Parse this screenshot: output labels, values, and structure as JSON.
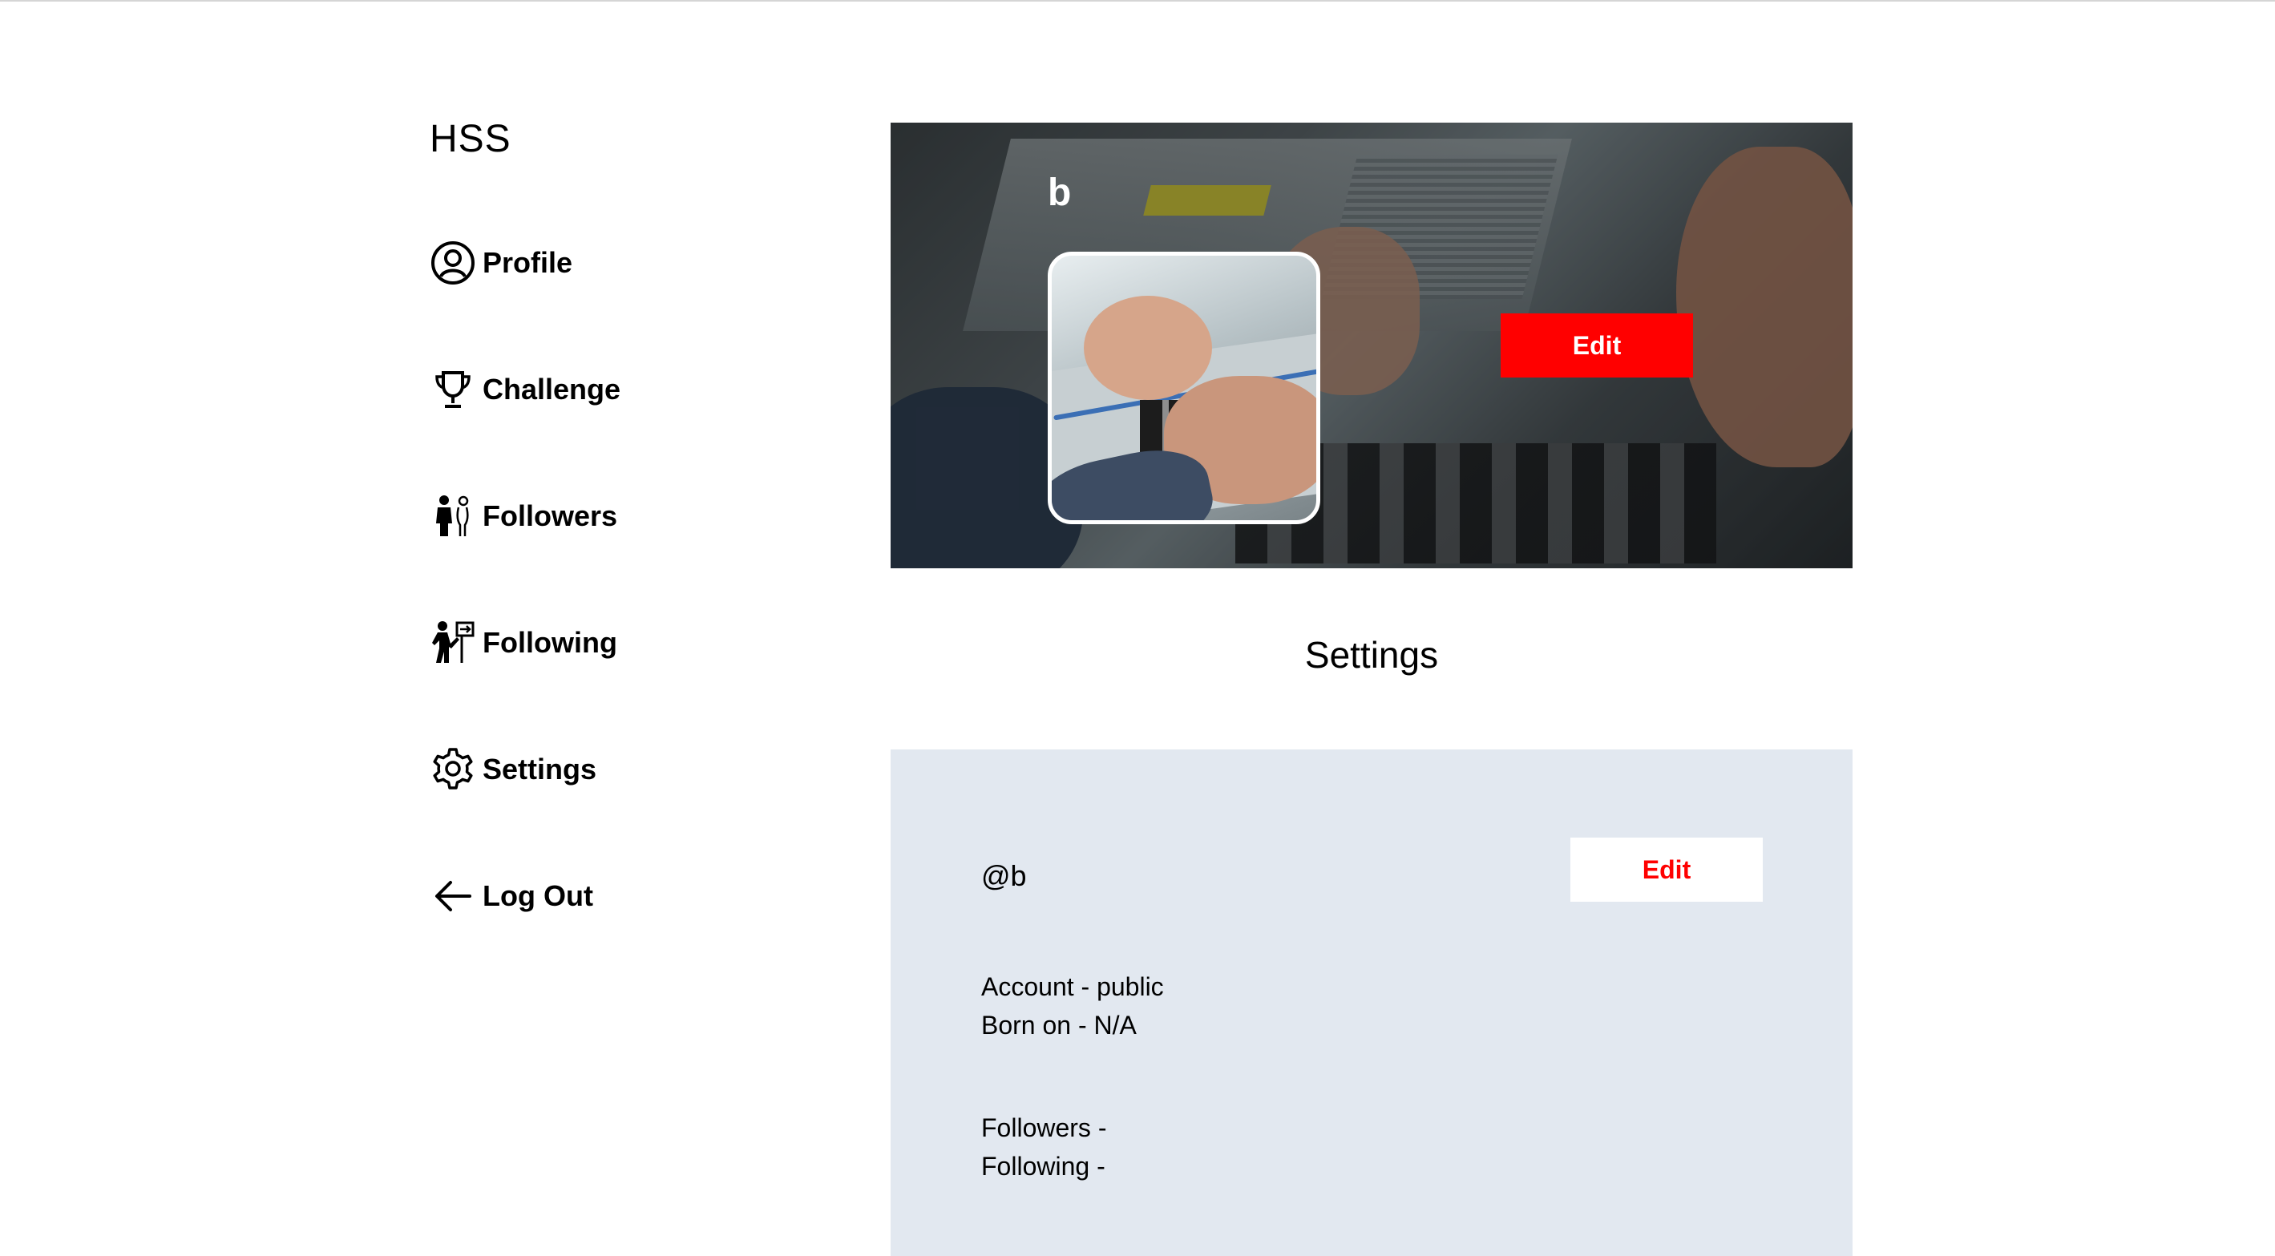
{
  "brand": "HSS",
  "nav": [
    {
      "label": "Profile",
      "icon": "profile-icon"
    },
    {
      "label": "Challenge",
      "icon": "trophy-icon"
    },
    {
      "label": "Followers",
      "icon": "followers-icon"
    },
    {
      "label": "Following",
      "icon": "following-icon"
    },
    {
      "label": "Settings",
      "icon": "gear-icon"
    },
    {
      "label": "Log Out",
      "icon": "arrow-left-icon"
    }
  ],
  "banner": {
    "username": "b",
    "edit_label": "Edit"
  },
  "page_title": "Settings",
  "settings": {
    "handle": "@b",
    "edit_label": "Edit",
    "account": "Account - public",
    "born_on": "Born on - N/A",
    "followers": "Followers -",
    "following": "Following -"
  },
  "colors": {
    "accent": "#ff0000",
    "panel_bg": "#e2e8f0"
  }
}
